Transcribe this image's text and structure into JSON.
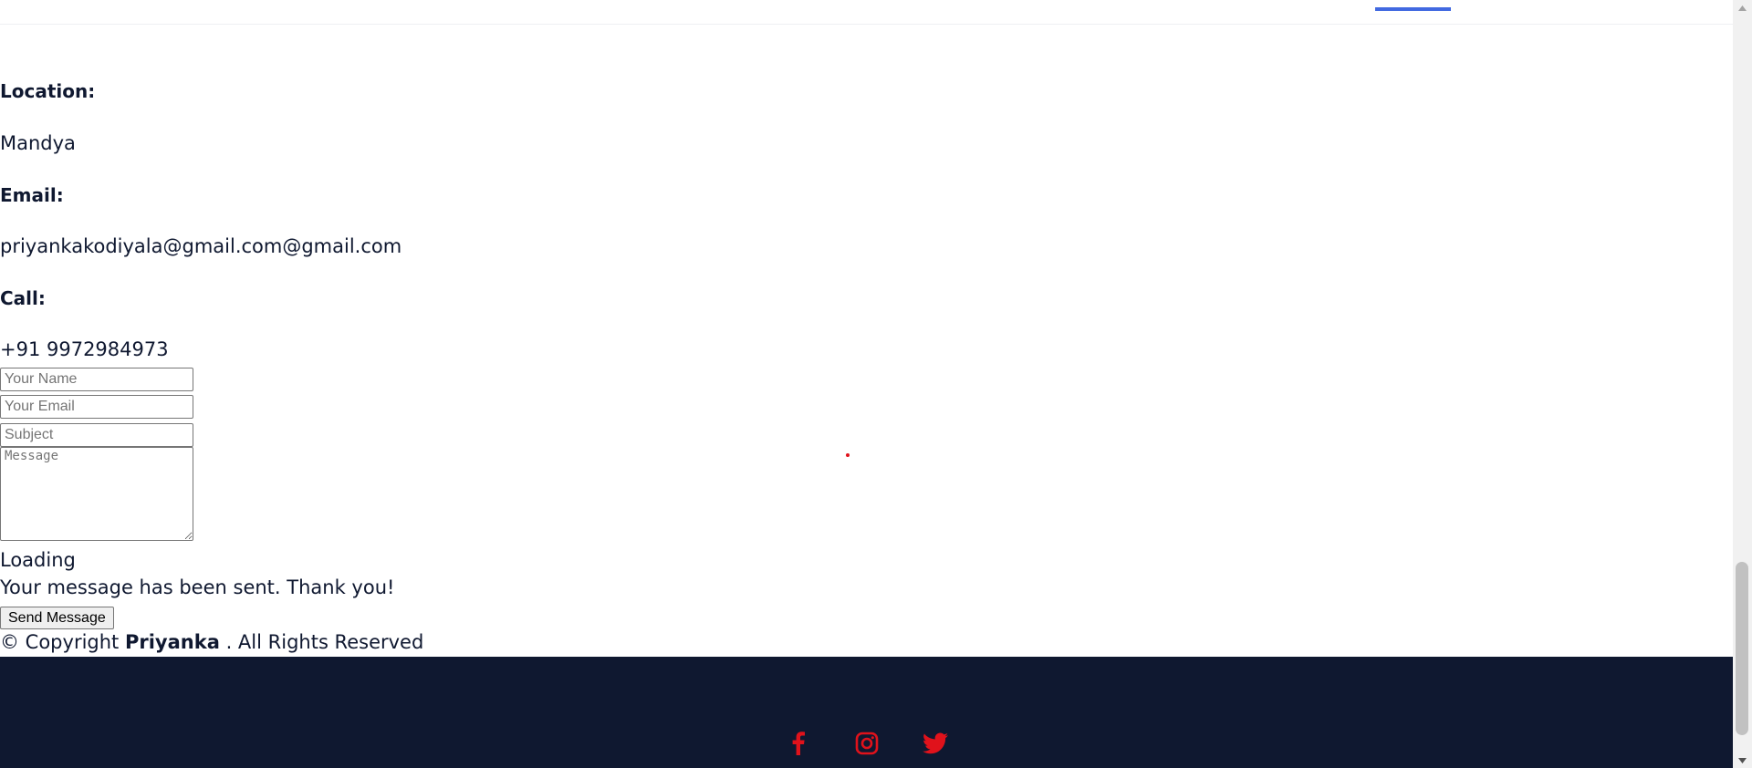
{
  "contact": {
    "location_label": "Location:",
    "location_value": "Mandya",
    "email_label": "Email:",
    "email_value": "priyankakodiyala@gmail.com@gmail.com",
    "call_label": "Call:",
    "call_value": "+91 9972984973"
  },
  "form": {
    "name_placeholder": "Your Name",
    "email_placeholder": "Your Email",
    "subject_placeholder": "Subject",
    "message_placeholder": "Message",
    "loading_text": "Loading",
    "sent_message": "Your message has been sent. Thank you!",
    "send_label": "Send Message"
  },
  "footer": {
    "copyright_prefix": "© Copyright",
    "copyright_name": "Priyanka",
    "copyright_suffix": ". All Rights Reserved",
    "social": [
      "facebook-icon",
      "instagram-icon",
      "twitter-icon"
    ]
  },
  "colors": {
    "accent": "#4169e1",
    "footer_bg": "#0f1830",
    "social_icon": "#e0121b",
    "text": "#0f1830"
  }
}
